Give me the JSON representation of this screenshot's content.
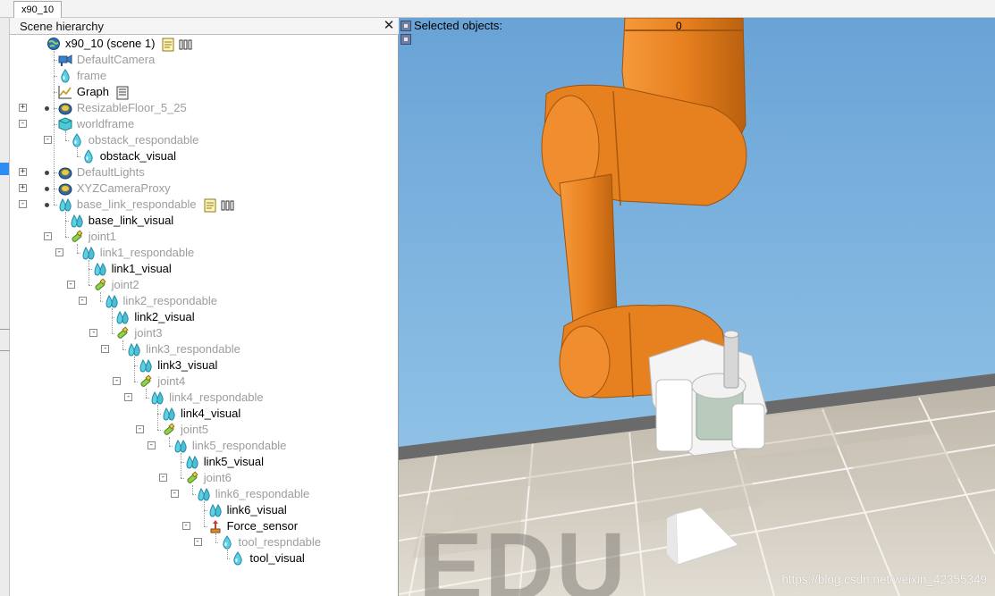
{
  "tab": {
    "label": "x90_10"
  },
  "panel": {
    "title": "Scene hierarchy",
    "close_glyph": "✕"
  },
  "tree": [
    {
      "label": "x90_10 (scene 1)",
      "depth": 0,
      "icon": "scene-globe-icon",
      "style": "dark",
      "expander": "",
      "dot": false,
      "extras": [
        "script-icon",
        "model-properties-icon"
      ]
    },
    {
      "label": "DefaultCamera",
      "depth": 1,
      "icon": "camera-icon",
      "style": "dim",
      "expander": "",
      "dot": false,
      "extras": []
    },
    {
      "label": "frame",
      "depth": 1,
      "icon": "shape-drop-icon",
      "style": "dim",
      "expander": "",
      "dot": false,
      "extras": []
    },
    {
      "label": "Graph",
      "depth": 1,
      "icon": "graph-icon",
      "style": "dark",
      "expander": "",
      "dot": false,
      "extras": [
        "document-icon"
      ]
    },
    {
      "label": "ResizableFloor_5_25",
      "depth": 1,
      "icon": "model-icon",
      "style": "dim",
      "expander": "+",
      "dot": true,
      "extras": []
    },
    {
      "label": "worldframe",
      "depth": 1,
      "icon": "dummy-cube-icon",
      "style": "dim",
      "expander": "-",
      "dot": false,
      "extras": []
    },
    {
      "label": "obstack_respondable",
      "depth": 2,
      "icon": "shape-drop-icon",
      "style": "dim",
      "expander": "-",
      "dot": false,
      "extras": []
    },
    {
      "label": "obstack_visual",
      "depth": 3,
      "icon": "shape-drop-icon",
      "style": "dark",
      "expander": "",
      "dot": false,
      "extras": []
    },
    {
      "label": "DefaultLights",
      "depth": 1,
      "icon": "model-icon",
      "style": "dim",
      "expander": "+",
      "dot": true,
      "extras": []
    },
    {
      "label": "XYZCameraProxy",
      "depth": 1,
      "icon": "model-icon",
      "style": "dim",
      "expander": "+",
      "dot": true,
      "extras": []
    },
    {
      "label": "base_link_respondable",
      "depth": 1,
      "icon": "multishape-icon",
      "style": "dim",
      "expander": "-",
      "dot": true,
      "extras": [
        "script-icon",
        "model-properties-icon"
      ]
    },
    {
      "label": "base_link_visual",
      "depth": 2,
      "icon": "multishape-icon",
      "style": "dark",
      "expander": "",
      "dot": false,
      "extras": []
    },
    {
      "label": "joint1",
      "depth": 2,
      "icon": "joint-icon",
      "style": "dim",
      "expander": "-",
      "dot": false,
      "extras": []
    },
    {
      "label": "link1_respondable",
      "depth": 3,
      "icon": "multishape-icon",
      "style": "dim",
      "expander": "-",
      "dot": false,
      "extras": []
    },
    {
      "label": "link1_visual",
      "depth": 4,
      "icon": "multishape-icon",
      "style": "dark",
      "expander": "",
      "dot": false,
      "extras": []
    },
    {
      "label": "joint2",
      "depth": 4,
      "icon": "joint-icon",
      "style": "dim",
      "expander": "-",
      "dot": false,
      "extras": []
    },
    {
      "label": "link2_respondable",
      "depth": 5,
      "icon": "multishape-icon",
      "style": "dim",
      "expander": "-",
      "dot": false,
      "extras": []
    },
    {
      "label": "link2_visual",
      "depth": 6,
      "icon": "multishape-icon",
      "style": "dark",
      "expander": "",
      "dot": false,
      "extras": []
    },
    {
      "label": "joint3",
      "depth": 6,
      "icon": "joint-icon",
      "style": "dim",
      "expander": "-",
      "dot": false,
      "extras": []
    },
    {
      "label": "link3_respondable",
      "depth": 7,
      "icon": "multishape-icon",
      "style": "dim",
      "expander": "-",
      "dot": false,
      "extras": []
    },
    {
      "label": "link3_visual",
      "depth": 8,
      "icon": "multishape-icon",
      "style": "dark",
      "expander": "",
      "dot": false,
      "extras": []
    },
    {
      "label": "joint4",
      "depth": 8,
      "icon": "joint-icon",
      "style": "dim",
      "expander": "-",
      "dot": false,
      "extras": []
    },
    {
      "label": "link4_respondable",
      "depth": 9,
      "icon": "multishape-icon",
      "style": "dim",
      "expander": "-",
      "dot": false,
      "extras": []
    },
    {
      "label": "link4_visual",
      "depth": 10,
      "icon": "multishape-icon",
      "style": "dark",
      "expander": "",
      "dot": false,
      "extras": []
    },
    {
      "label": "joint5",
      "depth": 10,
      "icon": "joint-icon",
      "style": "dim",
      "expander": "-",
      "dot": false,
      "extras": []
    },
    {
      "label": "link5_respondable",
      "depth": 11,
      "icon": "multishape-icon",
      "style": "dim",
      "expander": "-",
      "dot": false,
      "extras": []
    },
    {
      "label": "link5_visual",
      "depth": 12,
      "icon": "multishape-icon",
      "style": "dark",
      "expander": "",
      "dot": false,
      "extras": []
    },
    {
      "label": "joint6",
      "depth": 12,
      "icon": "joint-icon",
      "style": "dim",
      "expander": "-",
      "dot": false,
      "extras": []
    },
    {
      "label": "link6_respondable",
      "depth": 13,
      "icon": "multishape-icon",
      "style": "dim",
      "expander": "-",
      "dot": false,
      "extras": []
    },
    {
      "label": "link6_visual",
      "depth": 14,
      "icon": "multishape-icon",
      "style": "dark",
      "expander": "",
      "dot": false,
      "extras": []
    },
    {
      "label": "Force_sensor",
      "depth": 14,
      "icon": "force-sensor-icon",
      "style": "dark",
      "expander": "-",
      "dot": false,
      "extras": []
    },
    {
      "label": "tool_respndable",
      "depth": 15,
      "icon": "shape-drop-icon",
      "style": "dim",
      "expander": "-",
      "dot": false,
      "extras": []
    },
    {
      "label": "tool_visual",
      "depth": 16,
      "icon": "shape-drop-icon",
      "style": "dark",
      "expander": "",
      "dot": false,
      "extras": []
    }
  ],
  "viewport": {
    "selected_label": "Selected objects:",
    "selected_count": "0",
    "watermark_text": "EDU",
    "url_watermark": "https://blog.csdn.net/weixin_42355349"
  },
  "colors": {
    "robot_orange": "#e8801e",
    "robot_orange_dark": "#b65e10",
    "gripper_white": "#f2f2f2",
    "gripper_green": "#b9cbbd",
    "wall_sky": "#7bb0dc",
    "floor_tile": "#d8d2c6",
    "dim_text": "#9c9c9c"
  }
}
